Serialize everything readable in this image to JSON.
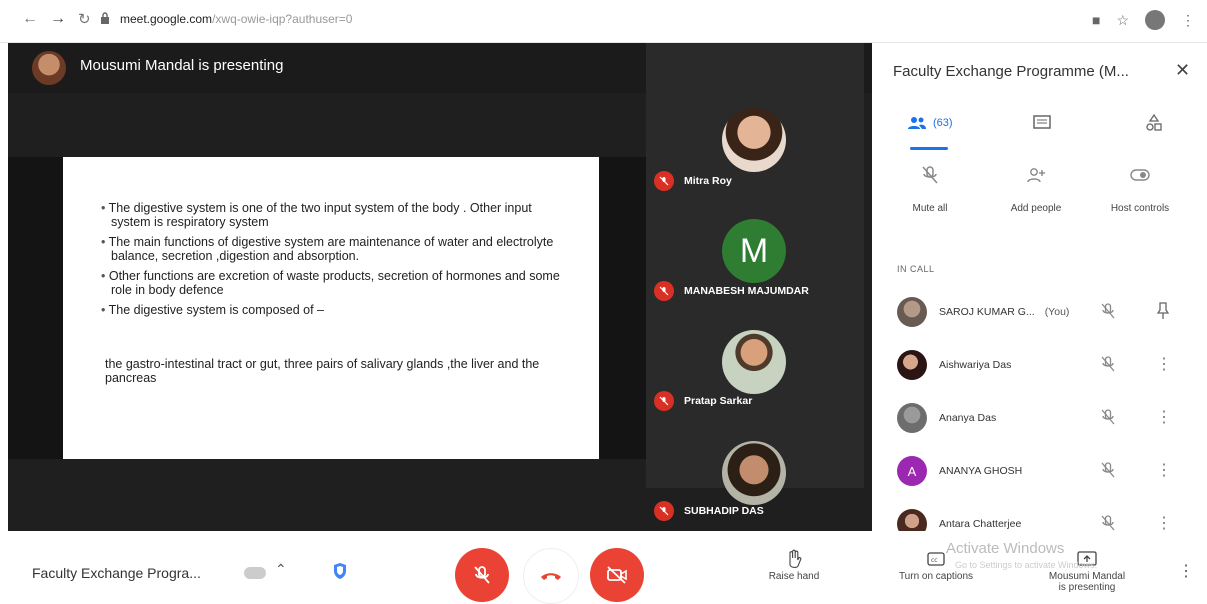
{
  "browser": {
    "url_host": "meet.google.com",
    "url_path": "/xwq-owie-iqp?authuser=0"
  },
  "presentation": {
    "presenting_text": "Mousumi Mandal is presenting",
    "slide": {
      "bullets": [
        "The digestive system is one of the two input system of the body . Other input system is respiratory system",
        "The main functions of digestive system are maintenance of water and electrolyte  balance, secretion ,digestion and absorption.",
        "Other functions are excretion of waste products, secretion of hormones and some role in body defence",
        "The digestive system is composed of –"
      ],
      "extra_text": "the gastro-intestinal tract or gut, three pairs of salivary glands ,the liver and the pancreas"
    }
  },
  "tiles": [
    {
      "name": "Mitra Roy",
      "avatar_color": "#c08a6b",
      "initial": ""
    },
    {
      "name": "MANABESH MAJUMDAR",
      "avatar_color": "#2e7d32",
      "initial": "M"
    },
    {
      "name": "Pratap Sarkar",
      "avatar_color": "#d9a07c",
      "initial": ""
    },
    {
      "name": "SUBHADIP DAS",
      "avatar_color": "#8a6a52",
      "initial": ""
    }
  ],
  "panel": {
    "title": "Faculty Exchange Programme (M...",
    "people_count": "(63)",
    "actions": {
      "mute_all": "Mute all",
      "add_people": "Add people",
      "host_controls": "Host controls"
    },
    "in_call_label": "IN CALL",
    "participants": [
      {
        "name": "SAROJ KUMAR G...",
        "you": "(You)",
        "avatar_color": "#9e8c80",
        "initial": ""
      },
      {
        "name": "Aishwariya Das",
        "you": "",
        "avatar_color": "#5b2a2a",
        "initial": ""
      },
      {
        "name": "Ananya Das",
        "you": "",
        "avatar_color": "#8e8e8e",
        "initial": ""
      },
      {
        "name": "ANANYA GHOSH",
        "you": "",
        "avatar_color": "#9c27b0",
        "initial": "A"
      },
      {
        "name": "Antara Chatterjee",
        "you": "",
        "avatar_color": "#7a4a3a",
        "initial": ""
      }
    ]
  },
  "bottom_bar": {
    "meeting_name": "Faculty Exchange Progra...",
    "raise_hand": "Raise hand",
    "captions": "Turn on captions",
    "presenting_line1": "Mousumi Mandal",
    "presenting_line2": "is presenting",
    "watermark_title": "Activate Windows",
    "watermark_sub": "Go to Settings to activate Windows."
  }
}
